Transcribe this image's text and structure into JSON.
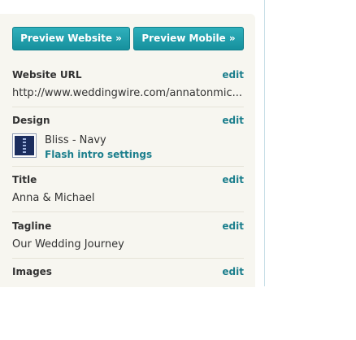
{
  "buttons": {
    "preview_website": "Preview Website »",
    "preview_mobile": "Preview Mobile »"
  },
  "sections": {
    "website_url": {
      "label": "Website URL",
      "edit": "edit",
      "value": "http://www.weddingwire.com/annatonmic..."
    },
    "design": {
      "label": "Design",
      "edit": "edit",
      "theme_name": "Bliss - Navy",
      "flash_link": "Flash intro settings"
    },
    "title": {
      "label": "Title",
      "edit": "edit",
      "value": "Anna & Michael"
    },
    "tagline": {
      "label": "Tagline",
      "edit": "edit",
      "value": "Our Wedding Journey"
    },
    "images": {
      "label": "Images",
      "edit": "edit"
    }
  },
  "colors": {
    "accent": "#1c7f8d",
    "button": "#1fa0ad",
    "panel_bg": "#f7f6f0"
  }
}
